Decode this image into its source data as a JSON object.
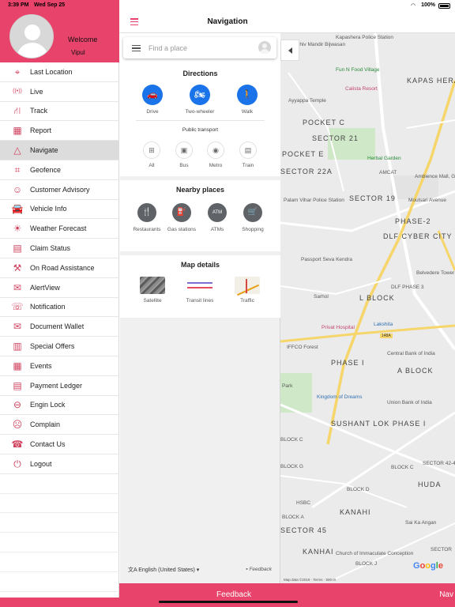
{
  "status_bar": {
    "time": "3:39 PM",
    "date": "Wed Sep 25",
    "battery": "100%"
  },
  "drawer": {
    "welcome": "Welcome",
    "username": "Vipul",
    "items": [
      {
        "label": "Last Location",
        "icon": "location-pin-icon"
      },
      {
        "label": "Live",
        "icon": "live-broadcast-icon"
      },
      {
        "label": "Track",
        "icon": "track-road-icon"
      },
      {
        "label": "Report",
        "icon": "report-icon"
      },
      {
        "label": "Navigate",
        "icon": "navigate-arrow-icon"
      },
      {
        "label": "Geofence",
        "icon": "geofence-map-icon"
      },
      {
        "label": "Customer Advisory",
        "icon": "customer-advisory-icon"
      },
      {
        "label": "Vehicle Info",
        "icon": "car-icon"
      },
      {
        "label": "Weather Forecast",
        "icon": "weather-sun-icon"
      },
      {
        "label": "Claim Status",
        "icon": "claim-status-icon"
      },
      {
        "label": "On Road Assistance",
        "icon": "road-assistance-icon"
      },
      {
        "label": "AlertView",
        "icon": "alert-bell-icon"
      },
      {
        "label": "Notification",
        "icon": "notification-chat-icon"
      },
      {
        "label": "Document Wallet",
        "icon": "document-wallet-icon"
      },
      {
        "label": "Special Offers",
        "icon": "special-offers-icon"
      },
      {
        "label": "Events",
        "icon": "calendar-icon"
      },
      {
        "label": "Payment Ledger",
        "icon": "payment-ledger-icon"
      },
      {
        "label": "Engin Lock",
        "icon": "engine-lock-icon"
      },
      {
        "label": "Complain",
        "icon": "complain-icon"
      },
      {
        "label": "Contact Us",
        "icon": "contact-phone-icon"
      },
      {
        "label": "Logout",
        "icon": "power-icon"
      }
    ],
    "active_index": 4
  },
  "header": {
    "title": "Navigation"
  },
  "search": {
    "placeholder": "Find a place"
  },
  "directions": {
    "title": "Directions",
    "modes": [
      {
        "label": "Drive",
        "icon": "car-icon"
      },
      {
        "label": "Two-wheeler",
        "icon": "motorbike-icon"
      },
      {
        "label": "Walk",
        "icon": "walking-icon"
      }
    ],
    "public_transport_title": "Public transport",
    "transit": [
      {
        "label": "All",
        "icon": "all-transit-icon"
      },
      {
        "label": "Bus",
        "icon": "bus-icon"
      },
      {
        "label": "Metro",
        "icon": "metro-icon"
      },
      {
        "label": "Train",
        "icon": "train-icon"
      }
    ]
  },
  "nearby": {
    "title": "Nearby places",
    "places": [
      {
        "label": "Restaurants",
        "icon": "restaurant-icon"
      },
      {
        "label": "Gas stations",
        "icon": "gas-station-icon"
      },
      {
        "label": "ATMs",
        "icon": "atm-icon",
        "glyph": "ATM"
      },
      {
        "label": "Shopping",
        "icon": "shopping-cart-icon"
      }
    ]
  },
  "map_details": {
    "title": "Map details",
    "items": [
      {
        "label": "Satellite"
      },
      {
        "label": "Transit lines"
      },
      {
        "label": "Traffic"
      }
    ]
  },
  "panel_footer": {
    "language": "English (United States)",
    "feedback": "Feedback"
  },
  "map": {
    "labels": [
      "Kapashera Police Station",
      "Shiv Mandir Bijwasan",
      "Fun N Food Village",
      "KAPAS HERA ESTATE",
      "Calista Resort",
      "Ayyappa Temple",
      "POCKET C",
      "SECTOR 21",
      "POCKET E",
      "Herbal Garden",
      "SECTOR 22A",
      "AMCAT",
      "Ambience Mall, Gurugram",
      "Palam Vihar Police Station",
      "SECTOR 19",
      "Moulsari Avenue",
      "PHASE-2",
      "DLF CYBER CITY",
      "Passport Seva Kendra",
      "DLF PHASE 3",
      "Belvedere Tower",
      "Sarhol",
      "L BLOCK",
      "Lakshita",
      "Privat Hospital",
      "IFFCO Forest",
      "PHASE I",
      "Central Bank of India",
      "A BLOCK",
      "Park",
      "Kingdom of Dreams",
      "Union Bank of India",
      "SUSHANT LOK PHASE I",
      "BLOCK C",
      "BLOCK G",
      "BLOCK D",
      "BLOCK C",
      "SECTOR 42-43",
      "HUDA",
      "HSBC",
      "KANAHI",
      "Sai Ka Angan",
      "BLOCK A",
      "SECTOR 45",
      "Church of Immaculate Conception",
      "KANHAI",
      "BLOCK J",
      "SECTOR"
    ],
    "road_badge": "148A",
    "footer": "Map data ©2019 · Terms · 500 m"
  },
  "bottom_bar": {
    "feedback": "Feedback",
    "navigate": "Nav"
  },
  "colors": {
    "brand": "#e8436a",
    "blue": "#1a73e8"
  }
}
